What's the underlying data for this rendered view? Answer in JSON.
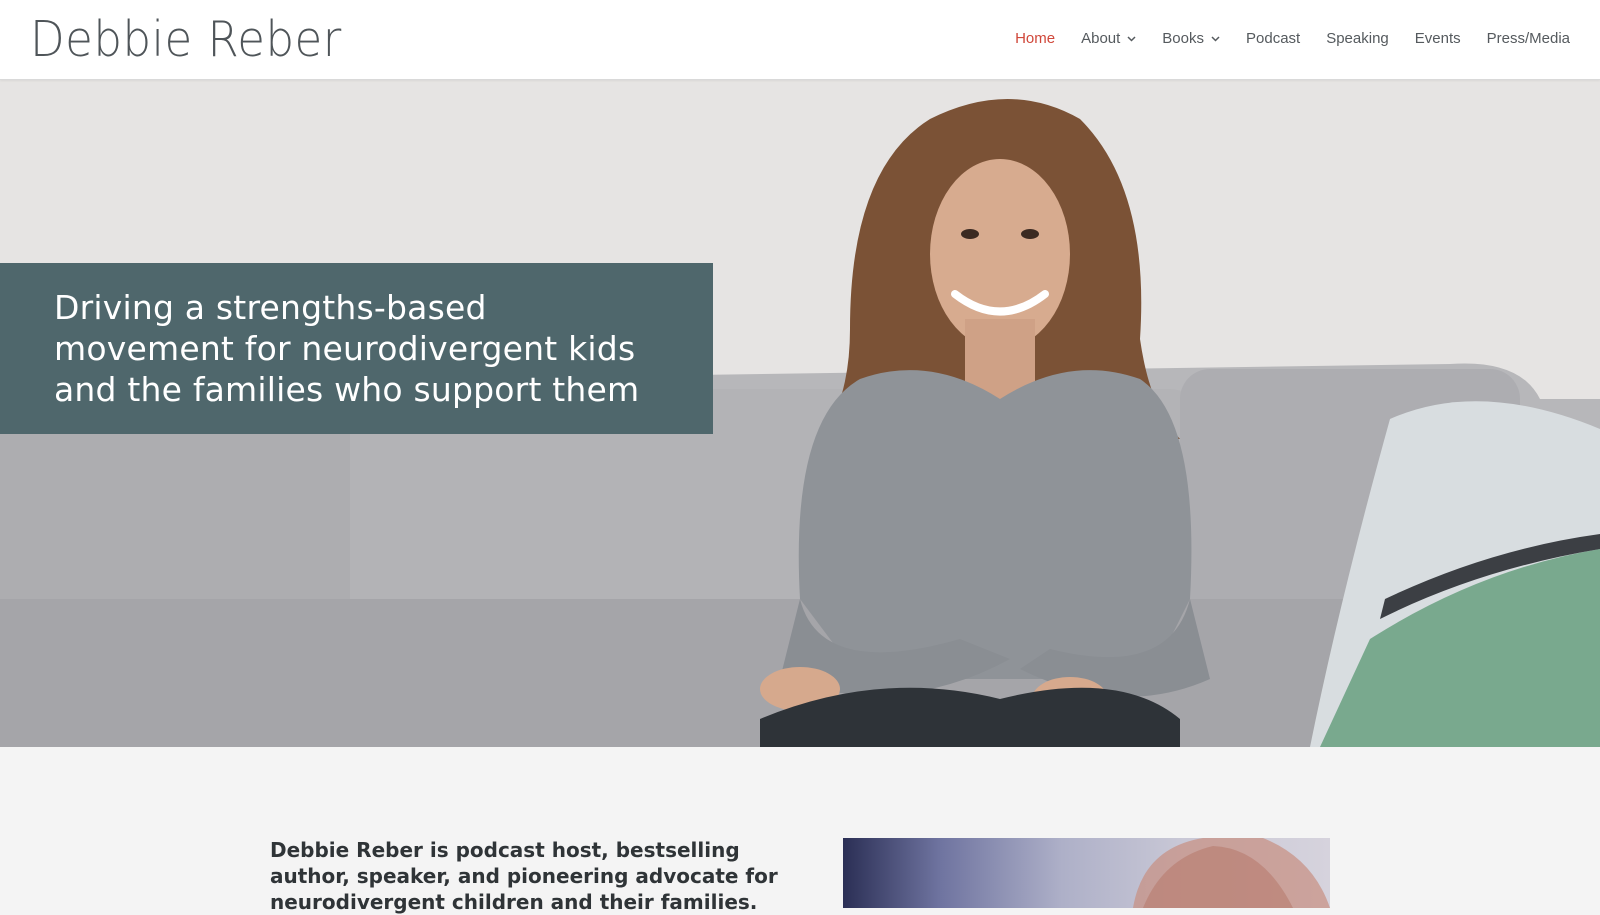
{
  "header": {
    "logo": "Debbie Reber",
    "nav": [
      {
        "label": "Home",
        "active": true,
        "dropdown": false
      },
      {
        "label": "About",
        "active": false,
        "dropdown": true
      },
      {
        "label": "Books",
        "active": false,
        "dropdown": true
      },
      {
        "label": "Podcast",
        "active": false,
        "dropdown": false
      },
      {
        "label": "Speaking",
        "active": false,
        "dropdown": false
      },
      {
        "label": "Events",
        "active": false,
        "dropdown": false
      },
      {
        "label": "Press/Media",
        "active": false,
        "dropdown": false
      }
    ]
  },
  "hero": {
    "tagline_lines": [
      "Driving a strengths-based",
      "movement for neurodivergent kids",
      "and the families who support them"
    ]
  },
  "intro": {
    "text": "Debbie Reber is podcast host, bestselling author, speaker, and pioneering advocate for neurodivergent children and their families."
  },
  "colors": {
    "accent": "#d0473a",
    "tagline_bg": "#4f676c",
    "nav_text": "#555a5e",
    "logo": "#4f5559"
  },
  "icons": {
    "dropdown": "chevron-down-icon"
  }
}
